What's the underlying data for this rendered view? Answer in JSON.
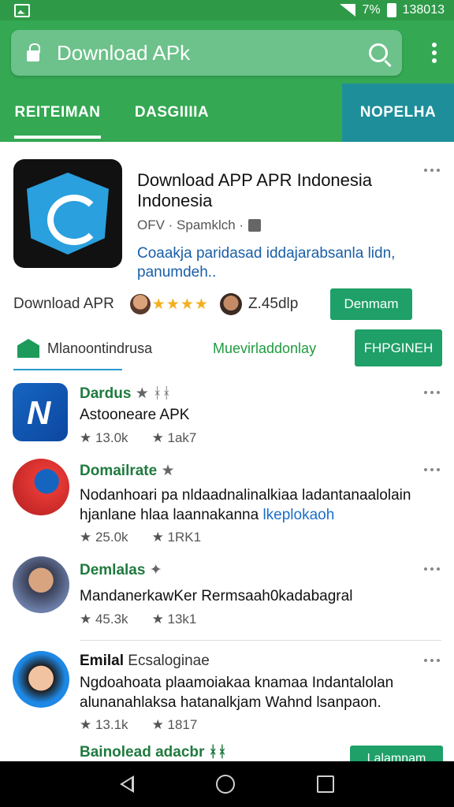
{
  "status_bar": {
    "right_text": "7%",
    "time": "138013"
  },
  "search": {
    "text": "Download APk"
  },
  "tabs": [
    {
      "label": "REITEIMAN"
    },
    {
      "label": "DASGIIIIA"
    },
    {
      "label": "NOPELHA"
    }
  ],
  "hero": {
    "title": "Download APP APR Indonesia Indonesia",
    "developer": "OFV · Spamklch ·",
    "description": "Coaakja paridasad iddajarabsanla lidn, panumdeh..",
    "download_label": "Download APR",
    "rating_stars": "★★★★",
    "rating_count": "Z.45dlp",
    "install_button": "Denmam"
  },
  "subtabs": {
    "first": "Mlanoontindrusa",
    "second": "Muevirladdonlay",
    "button": "FHPGINEH"
  },
  "list": [
    {
      "title": "Dardus",
      "title_extra": "★ ᚼᚼ",
      "text": "Astooneare APK",
      "stats": [
        "★ 13.0k",
        "★ 1ak7"
      ]
    },
    {
      "title": "Domailrate",
      "title_extra": "★",
      "text": "Nodanhoari pa nldaadnalinalkiaa ladantanaalolain hjanlane hlaa laannakanna",
      "text_link": "lkeplokaoh",
      "stats": [
        "★ 25.0k",
        "★ 1RK1"
      ]
    },
    {
      "title": "Demlalas",
      "title_extra": "✦",
      "text": "MandanerkawKer Rermsaah0kadabagral",
      "stats": [
        "★ 45.3k",
        "★ 13k1"
      ]
    },
    {
      "title": "Emilal",
      "title_extra": "Ecsaloginae",
      "text": "Ngdoahoata plaamoiakaa knamaa Indantalolan alunanahlaksa hatanalkjam Wahnd lsanpaon.",
      "stats": [
        "★ 13.1k",
        "★ 1817"
      ]
    }
  ],
  "bottom": {
    "title": "Bainolead adacbr",
    "title_extra": "ᚼᚼ",
    "button": "Lalamnam"
  },
  "colors": {
    "header_green": "#34a853",
    "status_green": "#2e9a48",
    "teal_tab": "#1e8f9a",
    "button_green": "#1ea068",
    "title_green": "#1f7a3e",
    "link_blue": "#1a5fa8"
  },
  "icons": [
    "image-icon",
    "signal-icon",
    "battery-icon",
    "lock-icon",
    "search-icon",
    "more-vert-icon",
    "puzzle-icon",
    "store-icon",
    "back-icon",
    "home-icon",
    "recents-icon"
  ]
}
